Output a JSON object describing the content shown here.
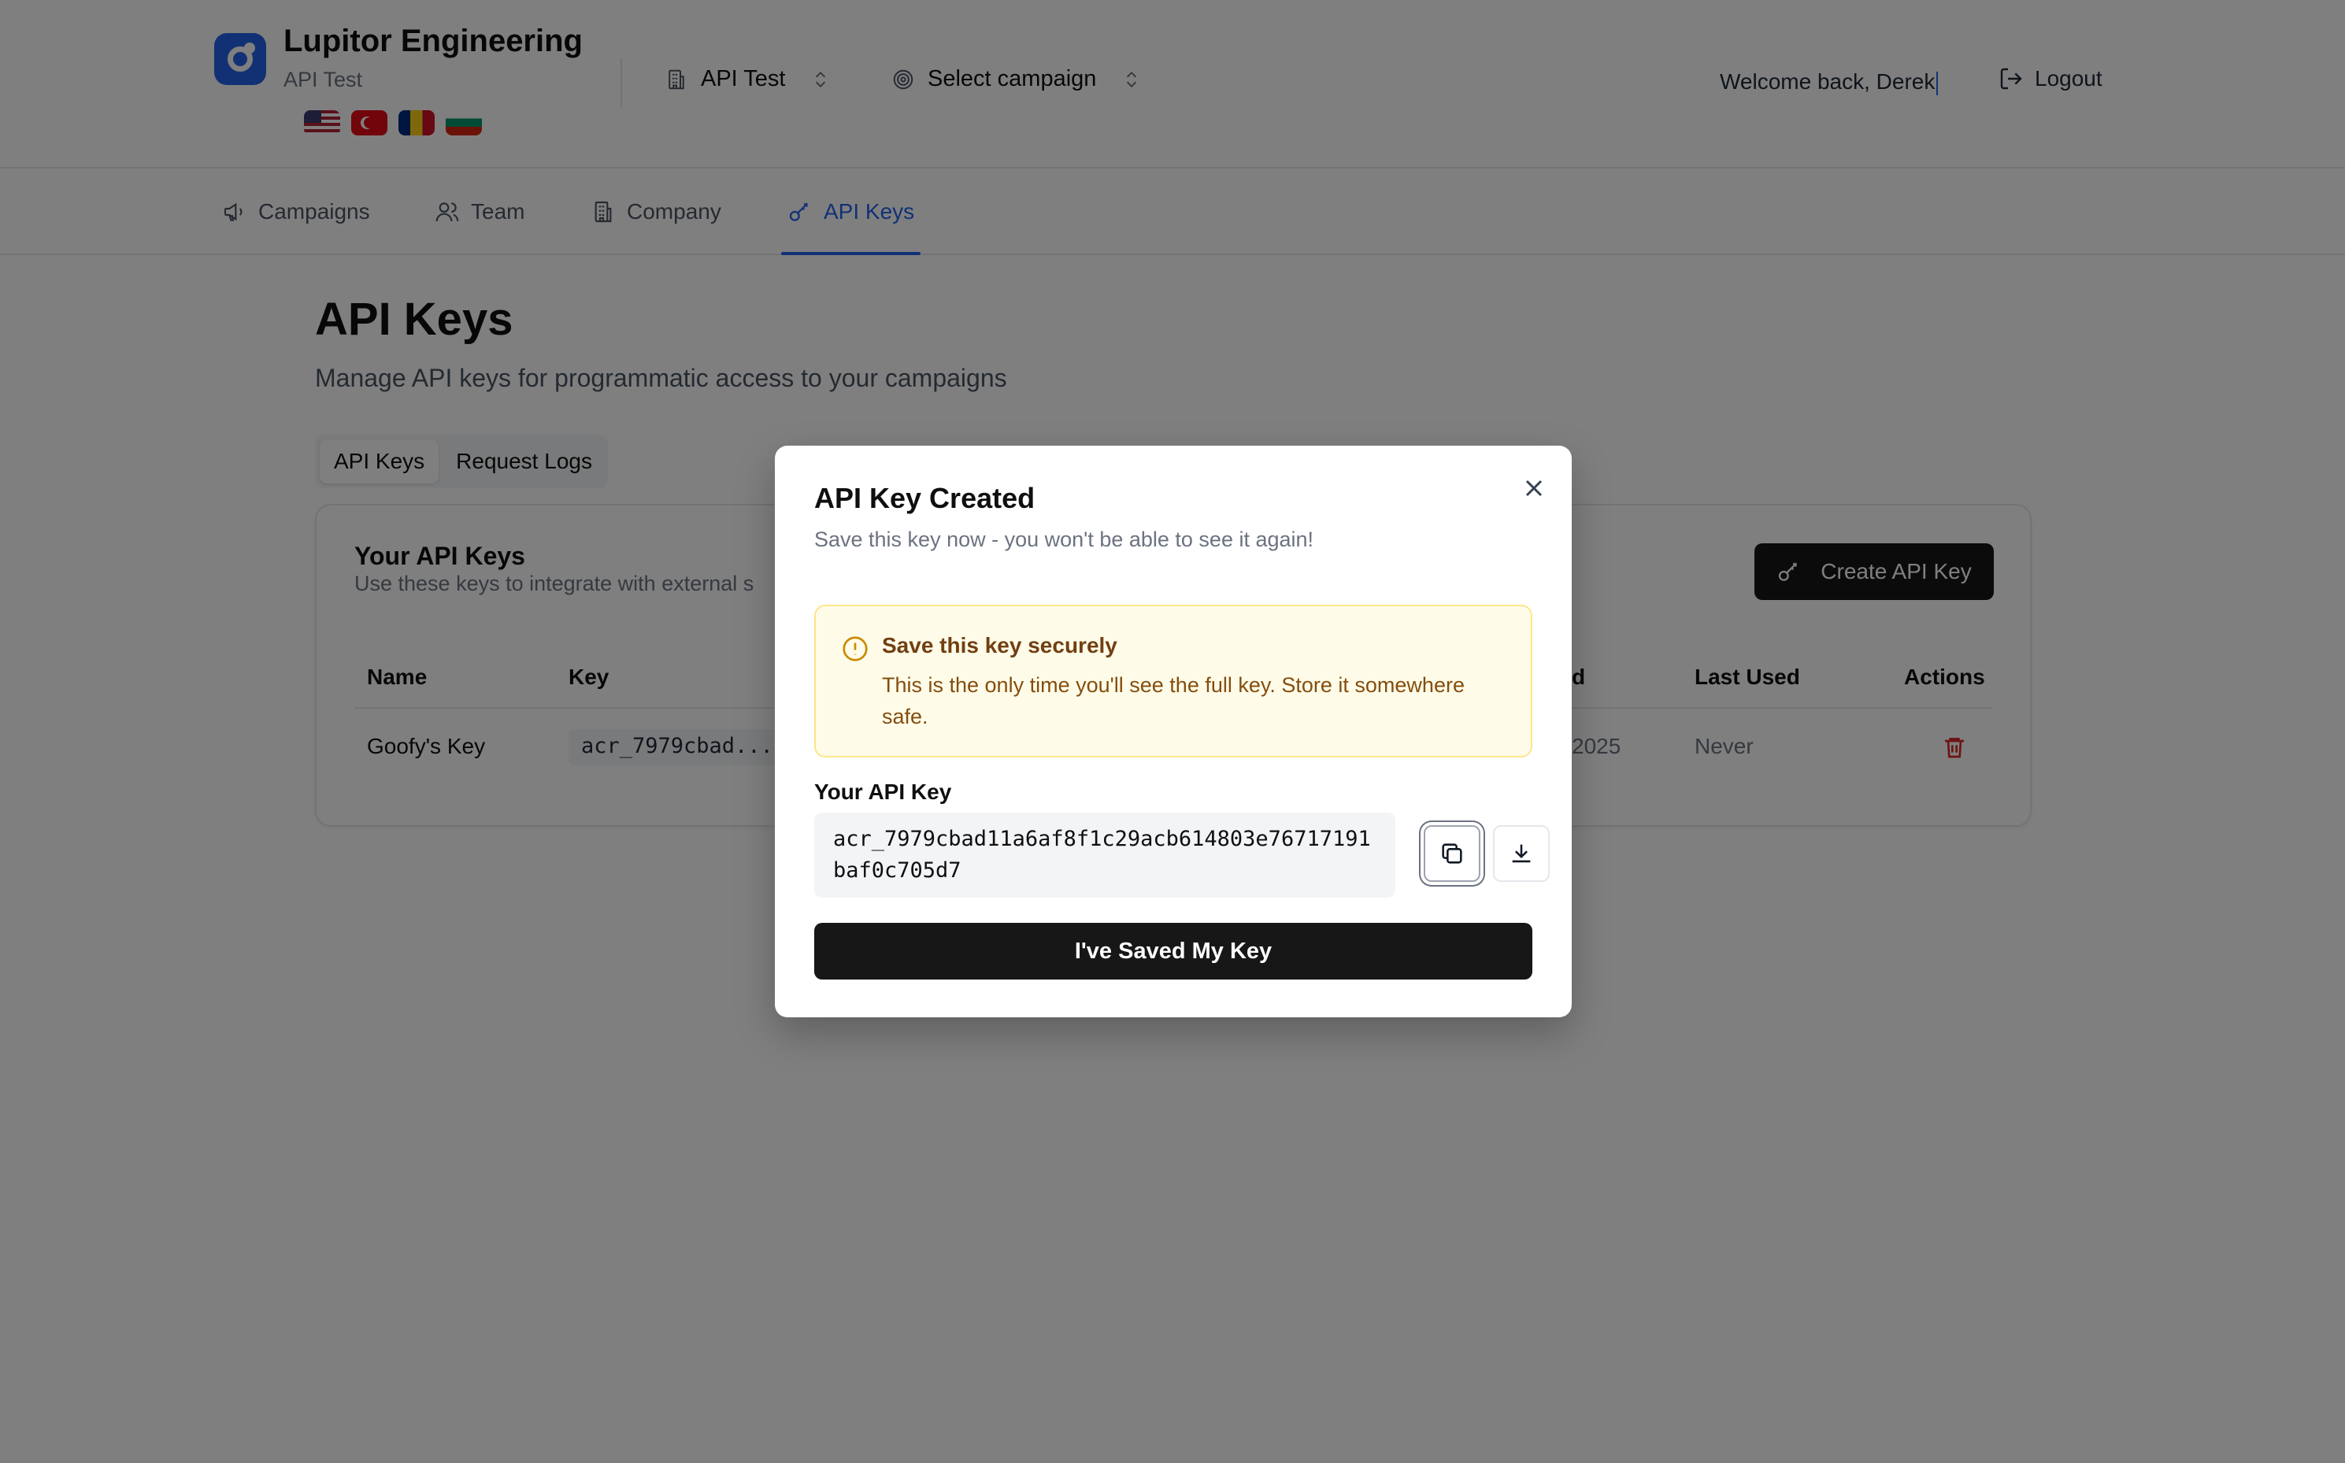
{
  "header": {
    "brand_title": "Lupitor Engineering",
    "brand_subtitle": "API Test",
    "flags": [
      "us-flag",
      "turkey-flag",
      "romania-flag",
      "bulgaria-flag"
    ],
    "company_selector": "API Test",
    "campaign_selector": "Select campaign",
    "welcome": "Welcome back, Derek",
    "logout": "Logout"
  },
  "nav": {
    "tabs": [
      {
        "label": "Campaigns",
        "icon": "megaphone-icon"
      },
      {
        "label": "Team",
        "icon": "users-icon"
      },
      {
        "label": "Company",
        "icon": "building-icon"
      },
      {
        "label": "API Keys",
        "icon": "key-icon",
        "active": true
      }
    ]
  },
  "main": {
    "title": "API Keys",
    "subtitle": "Manage API keys for programmatic access to your campaigns",
    "segments": [
      {
        "label": "API Keys",
        "active": true
      },
      {
        "label": "Request Logs",
        "active": false
      }
    ],
    "card": {
      "title": "Your API Keys",
      "subtitle": "Use these keys to integrate with external s",
      "create_button": "Create API Key",
      "columns": {
        "name": "Name",
        "key": "Key",
        "created_fragment": "d",
        "last_used": "Last Used",
        "actions": "Actions"
      },
      "rows": [
        {
          "name": "Goofy's Key",
          "key": "acr_7979cbad...",
          "created_fragment": "2025",
          "last_used": "Never"
        }
      ]
    }
  },
  "modal": {
    "title": "API Key Created",
    "description": "Save this key now - you won't be able to see it again!",
    "warning_title": "Save this key securely",
    "warning_body": "This is the only time you'll see the full key. Store it somewhere safe.",
    "key_label": "Your API Key",
    "key_value": "acr_7979cbad11a6af8f1c29acb614803e76717191baf0c705d7",
    "confirm_button": "I've Saved My Key"
  },
  "colors": {
    "accent": "#2563eb",
    "primary_button": "#171717",
    "danger": "#dc2626",
    "warning_bg": "#fefce8",
    "warning_border": "#fde68a",
    "warning_text": "#854d0e"
  }
}
